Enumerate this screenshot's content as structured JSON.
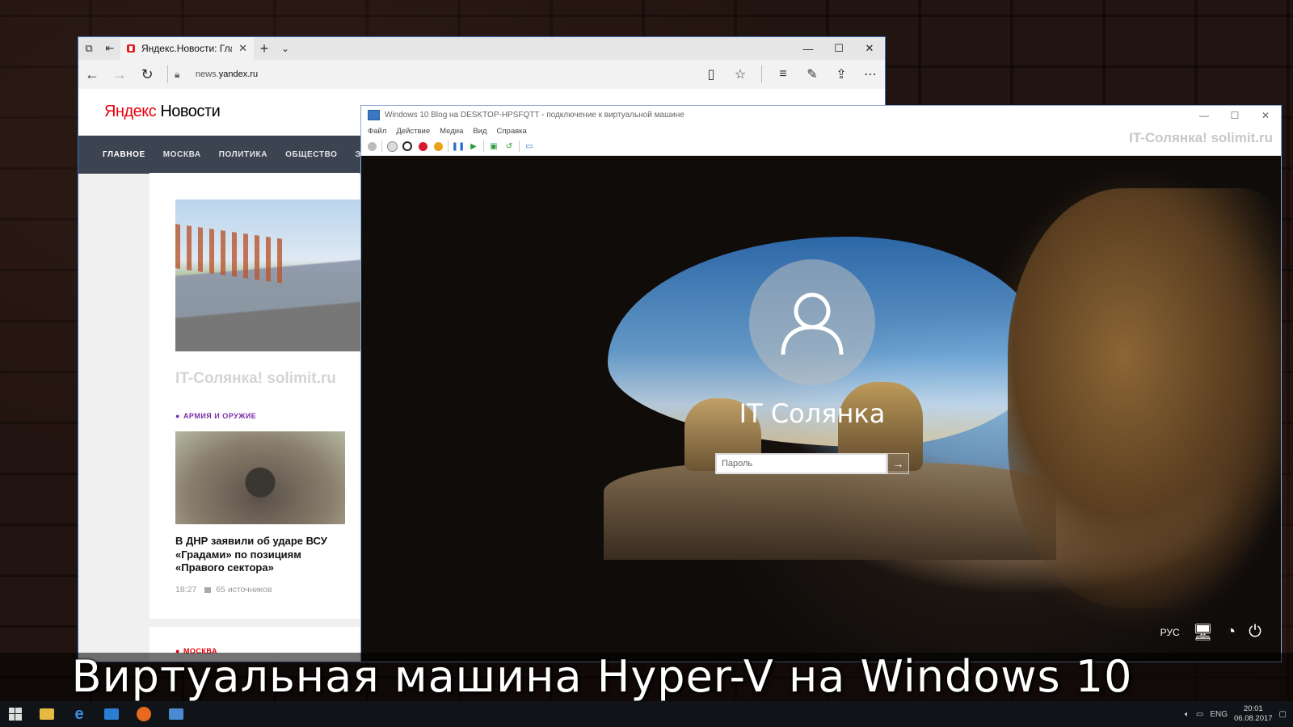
{
  "edge": {
    "tab_title": "Яндекс.Новости: Главн",
    "url_domain": "yandex.ru",
    "url_prefix": "news.",
    "close_tab_glyph": "✕",
    "new_tab_glyph": "+",
    "tab_menu_glyph": "⌄",
    "window_controls": [
      "—",
      "☐",
      "✕"
    ],
    "toolbar_icons": [
      "reading-view-icon",
      "favorite-star-icon",
      "hub-icon",
      "web-note-icon",
      "share-icon",
      "more-icon"
    ]
  },
  "yandex": {
    "logo_ya": "Яндекс",
    "logo_rest": " Новости",
    "nav": [
      "ГЛАВНОЕ",
      "МОСКВА",
      "ПОЛИТИКА",
      "ОБЩЕСТВО",
      "ЭКС"
    ],
    "watermark": "IT-Солянка! solimit.ru",
    "rubric": "АРМИЯ И ОРУЖИЕ",
    "headline": "В ДНР заявили об ударе ВСУ «Градами» по позициям «Правого сектора»",
    "time": "18:27",
    "sources": "65 источников",
    "rubric2": "МОСКВА"
  },
  "vm": {
    "title": "Windows 10 Blog на DESKTOP-HPSFQTT - подключение к виртуальной машине",
    "menu": [
      "Файл",
      "Действие",
      "Медиа",
      "Вид",
      "Справка"
    ],
    "watermark": "IT-Солянка! solimit.ru",
    "username": "IT Солянка",
    "password_placeholder": "Пароль",
    "language": "РУС",
    "submit_glyph": "→"
  },
  "caption": "Виртуальная машина Hyper-V на Windows 10",
  "taskbar": {
    "lang": "ENG",
    "time": "20:01",
    "date": "06.08.2017"
  },
  "colors": {
    "yandex_red": "#e8000b",
    "nav_bg": "#3d4451",
    "rubric_purple": "#7b2ea8",
    "window_border": "#3a6fb5"
  }
}
